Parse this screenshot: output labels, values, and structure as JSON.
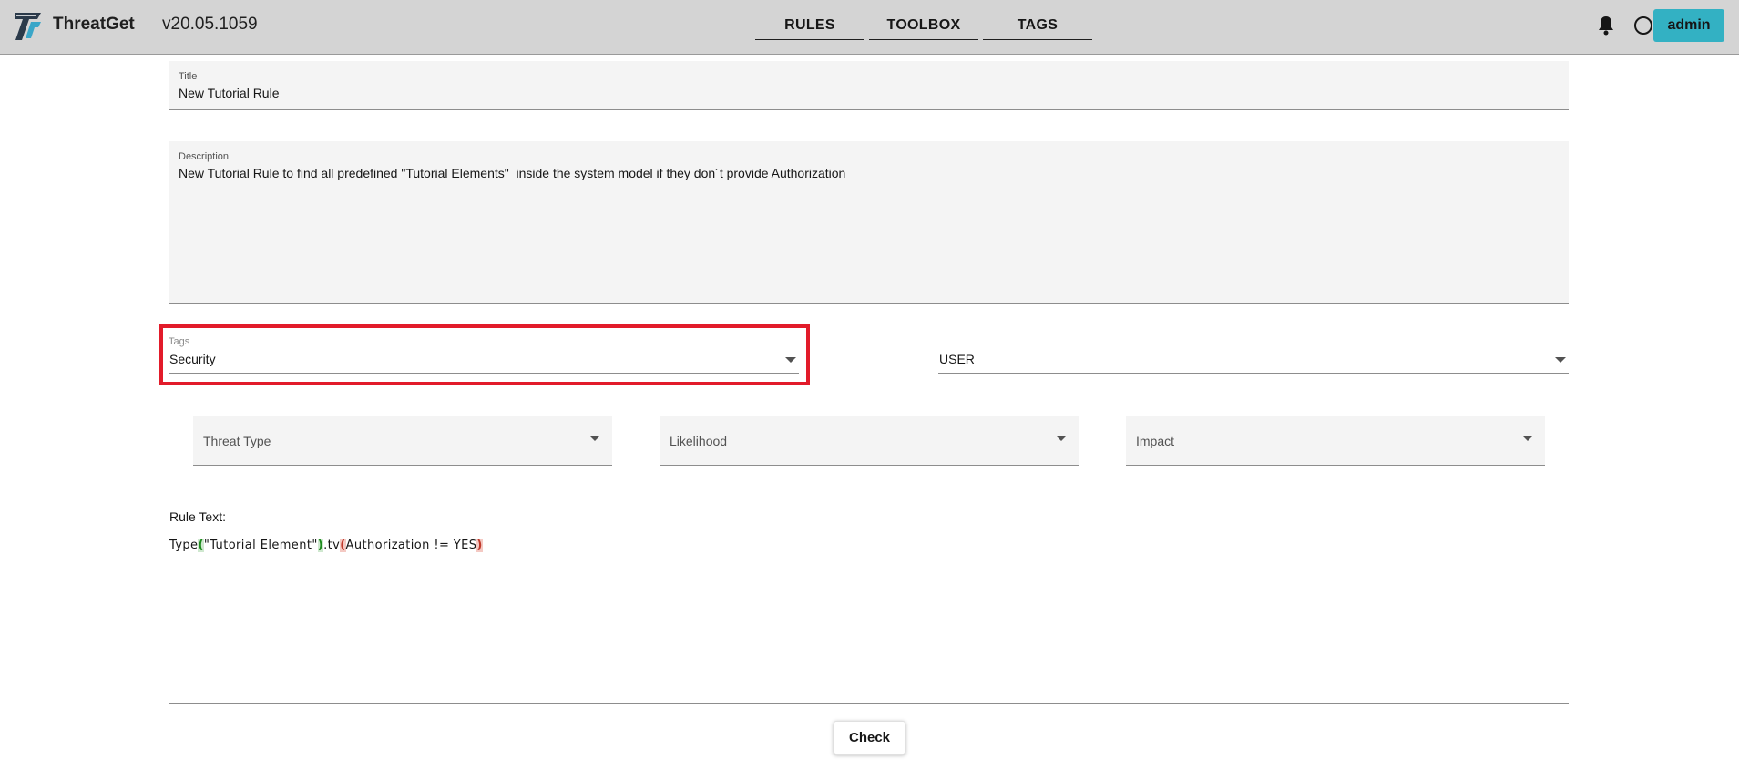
{
  "header": {
    "logo_icon": "threatget-logo-icon",
    "brand": "ThreatGet",
    "version": "v20.05.1059",
    "nav": [
      {
        "label": "RULES"
      },
      {
        "label": "TOOLBOX"
      },
      {
        "label": "TAGS"
      }
    ],
    "notification_icon": "bell-icon",
    "status_icon": "circle-icon",
    "user_button": "admin",
    "accent_color": "#33b1c3"
  },
  "form": {
    "title": {
      "label": "Title",
      "value": "New Tutorial Rule"
    },
    "description": {
      "label": "Description",
      "value": "New Tutorial Rule to find all predefined \"Tutorial Elements\"  inside the system model if they don´t provide Authorization"
    },
    "tags": {
      "label": "Tags",
      "value": "Security"
    },
    "user": {
      "value": "USER"
    },
    "threat_type": {
      "placeholder": "Threat Type"
    },
    "likelihood": {
      "placeholder": "Likelihood"
    },
    "impact": {
      "placeholder": "Impact"
    },
    "rule_text_label": "Rule Text:",
    "rule_text": {
      "part1": "Type",
      "paren1_open": "(",
      "part2": "\"Tutorial Element\"",
      "paren1_close": ")",
      "part3": ".tv",
      "paren2_open": "(",
      "part4": "Authorization != YES",
      "paren2_close": ")"
    },
    "check_button": "Check",
    "highlight_color": "#e21b2a"
  }
}
